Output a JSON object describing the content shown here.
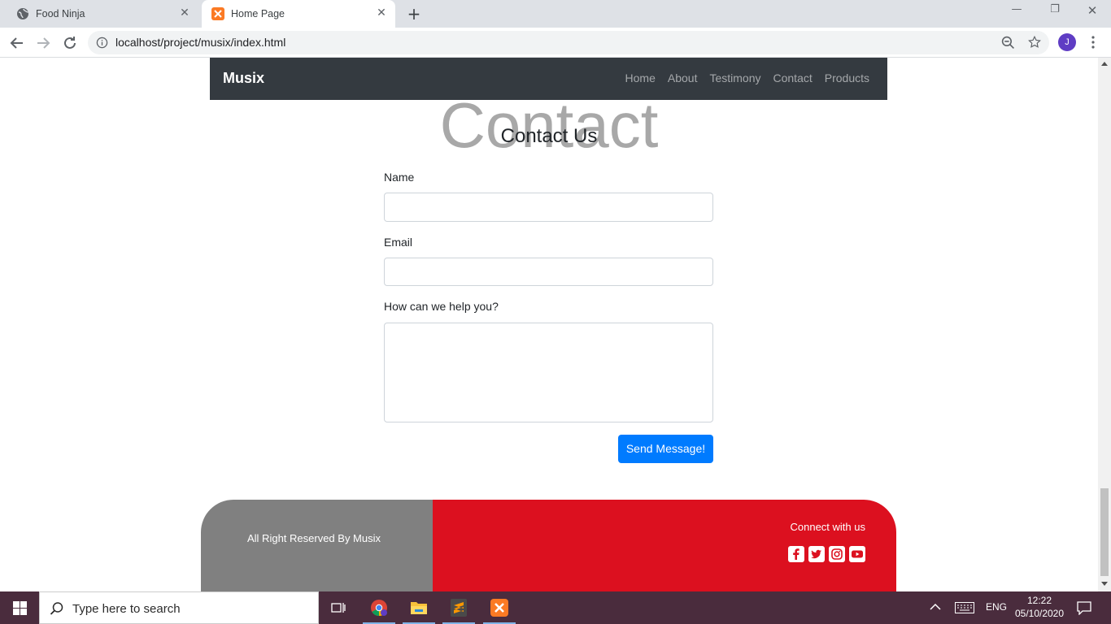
{
  "browser": {
    "tabs": [
      {
        "title": "Food Ninja",
        "icon": "globe-icon",
        "active": false
      },
      {
        "title": "Home Page",
        "icon": "xampp-icon",
        "active": true
      }
    ],
    "url": "localhost/project/musix/index.html",
    "profile_initial": "J"
  },
  "site": {
    "brand": "Musix",
    "nav_links": [
      "Home",
      "About",
      "Testimony",
      "Contact",
      "Products"
    ],
    "section_bg_word": "Contact",
    "section_title": "Contact Us",
    "form": {
      "name_label": "Name",
      "email_label": "Email",
      "message_label": "How can we help you?",
      "submit_label": "Send Message!"
    },
    "footer": {
      "rights": "All Right Reserved By Musix",
      "connect": "Connect with us",
      "social_icons": [
        "facebook-icon",
        "twitter-icon",
        "instagram-icon",
        "youtube-icon"
      ],
      "left_color": "#808080",
      "right_color": "#dc101f"
    },
    "navbar_color": "#343a40",
    "button_color": "#007bff"
  },
  "taskbar": {
    "search_placeholder": "Type here to search",
    "lang": "ENG",
    "time": "12:22",
    "date": "05/10/2020"
  }
}
